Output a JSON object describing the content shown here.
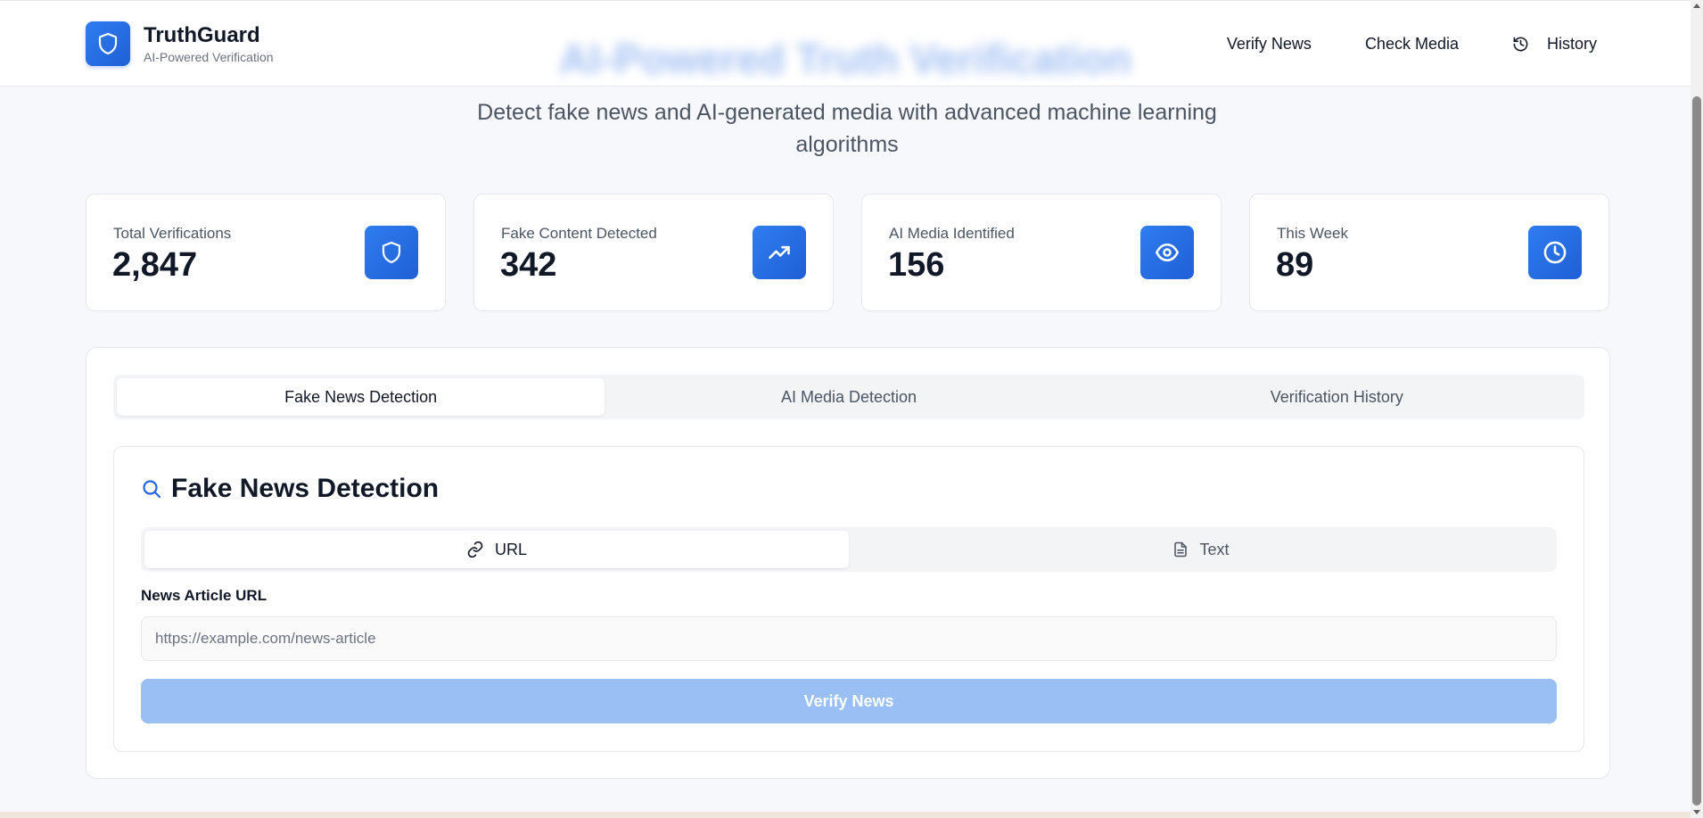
{
  "header": {
    "brand_title": "TruthGuard",
    "brand_subtitle": "AI-Powered Verification",
    "nav": {
      "verify_news": "Verify News",
      "check_media": "Check Media",
      "history": "History"
    }
  },
  "hero": {
    "title": "AI-Powered Truth Verification",
    "subtitle": "Detect fake news and AI-generated media with advanced machine learning algorithms"
  },
  "stats": [
    {
      "label": "Total Verifications",
      "value": "2,847",
      "icon": "shield-icon"
    },
    {
      "label": "Fake Content Detected",
      "value": "342",
      "icon": "trending-up-icon"
    },
    {
      "label": "AI Media Identified",
      "value": "156",
      "icon": "eye-icon"
    },
    {
      "label": "This Week",
      "value": "89",
      "icon": "clock-icon"
    }
  ],
  "tabs": {
    "fake_news": "Fake News Detection",
    "ai_media": "AI Media Detection",
    "history": "Verification History",
    "active": "fake_news"
  },
  "detection": {
    "title": "Fake News Detection",
    "subtabs": {
      "url": "URL",
      "text": "Text",
      "active": "url"
    },
    "field_label": "News Article URL",
    "url_value": "",
    "url_placeholder": "https://example.com/news-article",
    "submit_label": "Verify News"
  },
  "colors": {
    "accent": "#2563eb",
    "button_disabled": "#99bff4",
    "background": "#f7f8fc"
  }
}
